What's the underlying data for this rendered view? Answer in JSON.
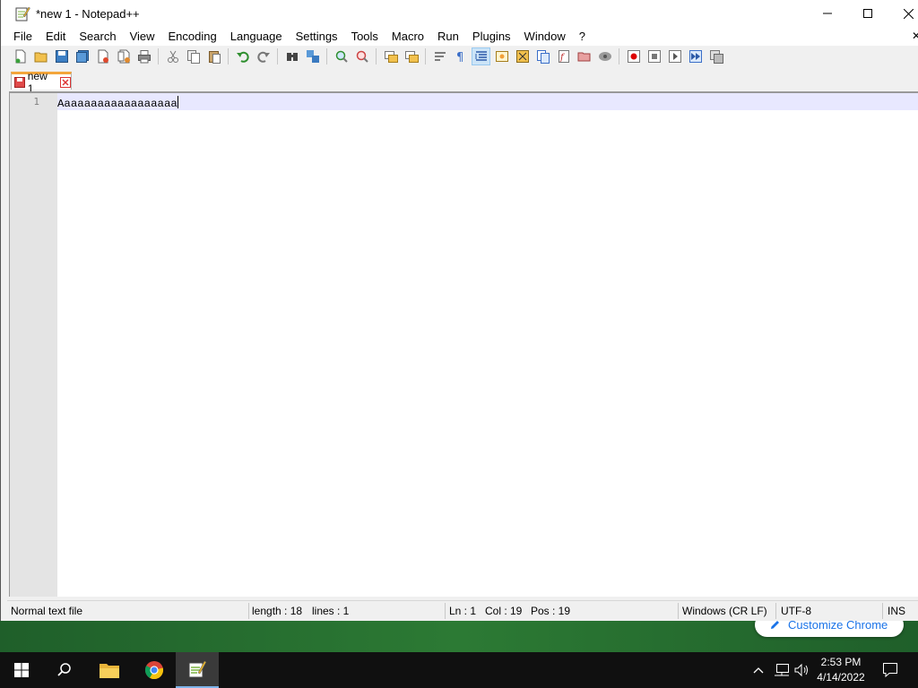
{
  "window": {
    "title": "*new 1 - Notepad++",
    "controls": [
      "minimize",
      "maximize",
      "close"
    ]
  },
  "menubar": {
    "items": [
      "File",
      "Edit",
      "Search",
      "View",
      "Encoding",
      "Language",
      "Settings",
      "Tools",
      "Macro",
      "Run",
      "Plugins",
      "Window",
      "?"
    ],
    "close_glyph": "✕"
  },
  "toolbar": {
    "icons": [
      "new-file-icon",
      "open-file-icon",
      "save-icon",
      "save-all-icon",
      "close-icon",
      "close-all-icon",
      "print-icon",
      "cut-icon",
      "copy-icon",
      "paste-icon",
      "undo-icon",
      "redo-icon",
      "find-icon",
      "replace-icon",
      "zoom-in-icon",
      "zoom-out-icon",
      "sync-vertical-icon",
      "sync-horizontal-icon",
      "word-wrap-icon",
      "show-all-characters-icon",
      "indent-guide-icon",
      "user-defined-language-icon",
      "document-map-icon",
      "document-list-icon",
      "function-list-icon",
      "folder-as-workspace-icon",
      "monitoring-icon",
      "record-macro-icon",
      "stop-recording-icon",
      "playback-macro-icon",
      "run-macro-multiple-icon",
      "save-macro-icon"
    ]
  },
  "tabs": [
    {
      "label": "new 1",
      "modified": true
    }
  ],
  "editor": {
    "lines": [
      {
        "number": "1",
        "text": "Aaaaaaaaaaaaaaaaaa"
      }
    ]
  },
  "statusbar": {
    "file_type": "Normal text file",
    "length": "length : 18",
    "lines": "lines : 1",
    "ln": "Ln : 1",
    "col": "Col : 19",
    "pos": "Pos : 19",
    "eol": "Windows (CR LF)",
    "encoding": "UTF-8",
    "mode": "INS"
  },
  "chrome_notice": {
    "label": "Customize Chrome"
  },
  "taskbar": {
    "apps": [
      "start-icon",
      "search-icon",
      "file-explorer-icon",
      "chrome-icon",
      "notepadpp-icon"
    ],
    "time": "2:53 PM",
    "date": "4/14/2022"
  },
  "colors": {
    "tab_accent": "#f3a53b",
    "current_line": "#e8e8ff",
    "gutter": "#e4e4e4",
    "chrome_link": "#1a73e8"
  }
}
